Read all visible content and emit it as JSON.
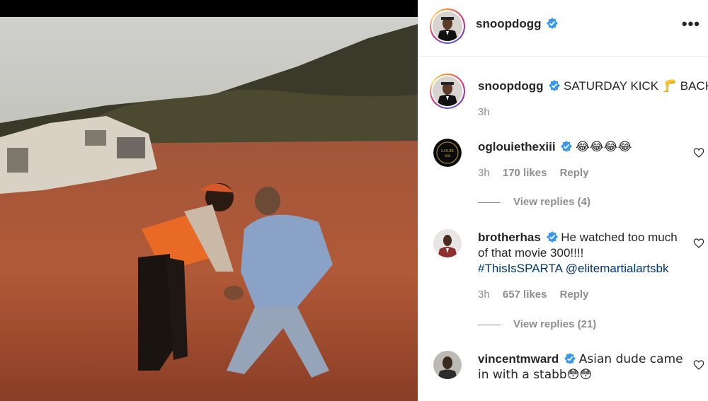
{
  "post": {
    "author": "snoopdogg",
    "caption": "SATURDAY KICK",
    "caption_emoji": "🦵",
    "caption_end": "BACK",
    "time": "3h"
  },
  "header": {
    "username": "snoopdogg",
    "more_icon": "more-horizontal-icon"
  },
  "comments": [
    {
      "username": "oglouiethexiii",
      "text": "😂😂😂😂",
      "time": "3h",
      "likes": "170 likes",
      "reply": "Reply",
      "view_replies": "View replies (4)",
      "avatar_text": "LOUIE THE XIII"
    },
    {
      "username": "brotherhas",
      "text": "He watched too much of that movie 300!!!!",
      "tags": "#ThisIsSPARTA @elitemartialartsbk",
      "time": "3h",
      "likes": "657 likes",
      "reply": "Reply",
      "view_replies": "View replies (21)"
    },
    {
      "username": "vincentmward",
      "text": "Asian dude came in with a stabb😳😳"
    }
  ],
  "colors": {
    "verified": "#3897f0",
    "meta": "#8e8e8e",
    "link": "#00376b",
    "divider": "#efefef"
  }
}
